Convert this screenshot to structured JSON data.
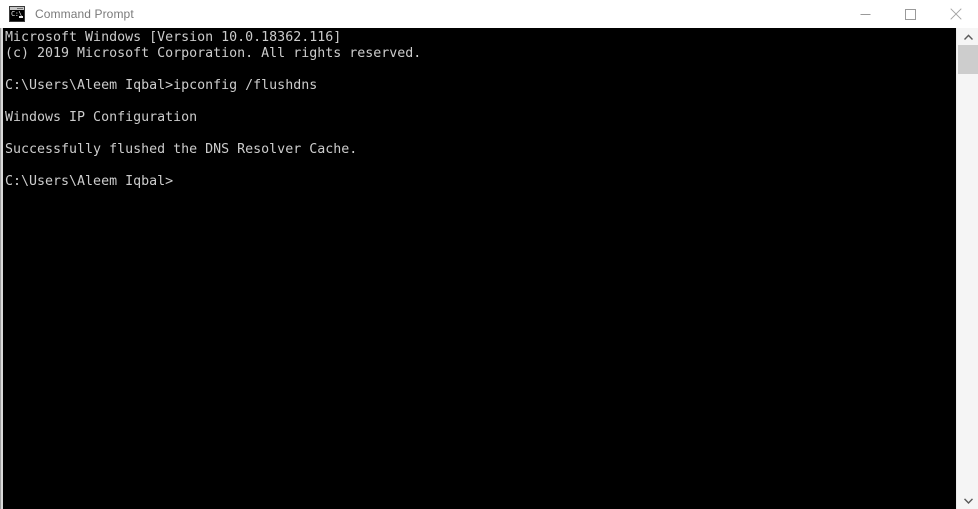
{
  "window": {
    "title": "Command Prompt",
    "icon": "command-prompt-icon",
    "icon_glyph": "C:\\",
    "controls": {
      "minimize_label": "Minimize",
      "maximize_label": "Maximize",
      "close_label": "Close"
    }
  },
  "console": {
    "background_color": "#000000",
    "text_color": "#cccccc",
    "lines": [
      "Microsoft Windows [Version 10.0.18362.116]",
      "(c) 2019 Microsoft Corporation. All rights reserved.",
      "",
      "C:\\Users\\Aleem Iqbal>ipconfig /flushdns",
      "",
      "Windows IP Configuration",
      "",
      "Successfully flushed the DNS Resolver Cache.",
      "",
      "C:\\Users\\Aleem Iqbal>"
    ],
    "text": "Microsoft Windows [Version 10.0.18362.116]\n(c) 2019 Microsoft Corporation. All rights reserved.\n\nC:\\Users\\Aleem Iqbal>ipconfig /flushdns\n\nWindows IP Configuration\n\nSuccessfully flushed the DNS Resolver Cache.\n\nC:\\Users\\Aleem Iqbal>"
  },
  "scrollbar": {
    "up_arrow": "chevron-up-icon",
    "down_arrow": "chevron-down-icon",
    "thumb_color": "#cdcdcd",
    "track_color": "#f5f5f5"
  }
}
